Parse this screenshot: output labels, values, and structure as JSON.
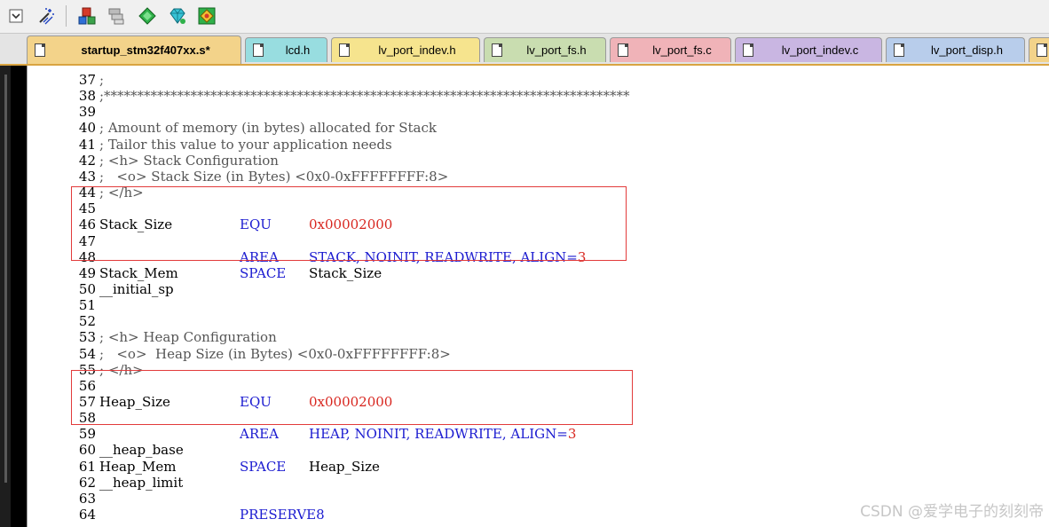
{
  "toolbar": {
    "buttons": [
      {
        "name": "dropdown-icon"
      },
      {
        "name": "magic-wand-icon"
      },
      {
        "name": "component-icon"
      },
      {
        "name": "stack-layers-icon"
      },
      {
        "name": "diamond-green-icon"
      },
      {
        "name": "gem-icon"
      },
      {
        "name": "network-pack-icon"
      }
    ]
  },
  "tabs": [
    {
      "label": "startup_stm32f407xx.s*",
      "color": "#f3d38a",
      "active": true
    },
    {
      "label": "lcd.h",
      "color": "#98dde0",
      "active": false
    },
    {
      "label": "lv_port_indev.h",
      "color": "#f6e48e",
      "active": false
    },
    {
      "label": "lv_port_fs.h",
      "color": "#c9ddb0",
      "active": false
    },
    {
      "label": "lv_port_fs.c",
      "color": "#f0b3b8",
      "active": false
    },
    {
      "label": "lv_port_indev.c",
      "color": "#c9b6e2",
      "active": false
    },
    {
      "label": "lv_port_disp.h",
      "color": "#b8cdeb",
      "active": false
    },
    {
      "label": "",
      "color": "#f3d38a",
      "active": false
    }
  ],
  "code": {
    "lines": [
      {
        "n": "37",
        "c1": ";",
        "c2": "",
        "c3": ""
      },
      {
        "n": "38",
        "c1": ";*******************************************************************************",
        "c2": "",
        "c3": ""
      },
      {
        "n": "39",
        "c1": "",
        "c2": "",
        "c3": ""
      },
      {
        "n": "40",
        "c1": "; Amount of memory (in bytes) allocated for Stack",
        "c2": "",
        "c3": ""
      },
      {
        "n": "41",
        "c1": "; Tailor this value to your application needs",
        "c2": "",
        "c3": ""
      },
      {
        "n": "42",
        "c1": "; <h> Stack Configuration",
        "c2": "",
        "c3": ""
      },
      {
        "n": "43",
        "c1": ";   <o> Stack Size (in Bytes) <0x0-0xFFFFFFFF:8>",
        "c2": "",
        "c3": ""
      },
      {
        "n": "44",
        "c1": "; </h>",
        "c2": "",
        "c3": ""
      },
      {
        "n": "45",
        "c1": "",
        "c2": "",
        "c3": ""
      },
      {
        "n": "46",
        "c1": "Stack_Size",
        "c2": "EQU",
        "c3": "0x00002000"
      },
      {
        "n": "47",
        "c1": "",
        "c2": "",
        "c3": ""
      },
      {
        "n": "48",
        "c1": "",
        "c2": "AREA",
        "c3": "STACK, NOINIT, READWRITE, ALIGN=",
        "c3b": "3"
      },
      {
        "n": "49",
        "c1": "Stack_Mem",
        "c2": "SPACE",
        "c3": "Stack_Size"
      },
      {
        "n": "50",
        "c1": "__initial_sp",
        "c2": "",
        "c3": ""
      },
      {
        "n": "51",
        "c1": "",
        "c2": "",
        "c3": ""
      },
      {
        "n": "52",
        "c1": "",
        "c2": "",
        "c3": ""
      },
      {
        "n": "53",
        "c1": "; <h> Heap Configuration",
        "c2": "",
        "c3": ""
      },
      {
        "n": "54",
        "c1": ";   <o>  Heap Size (in Bytes) <0x0-0xFFFFFFFF:8>",
        "c2": "",
        "c3": ""
      },
      {
        "n": "55",
        "c1": "; </h>",
        "c2": "",
        "c3": ""
      },
      {
        "n": "56",
        "c1": "",
        "c2": "",
        "c3": ""
      },
      {
        "n": "57",
        "c1": "Heap_Size",
        "c2": "EQU",
        "c3": "0x00002000"
      },
      {
        "n": "58",
        "c1": "",
        "c2": "",
        "c3": ""
      },
      {
        "n": "59",
        "c1": "",
        "c2": "AREA",
        "c3": "HEAP, NOINIT, READWRITE, ALIGN=",
        "c3b": "3"
      },
      {
        "n": "60",
        "c1": "__heap_base",
        "c2": "",
        "c3": ""
      },
      {
        "n": "61",
        "c1": "Heap_Mem",
        "c2": "SPACE",
        "c3": "Heap_Size"
      },
      {
        "n": "62",
        "c1": "__heap_limit",
        "c2": "",
        "c3": ""
      },
      {
        "n": "63",
        "c1": "",
        "c2": "",
        "c3": ""
      },
      {
        "n": "64",
        "c1": "",
        "c2": "PRESERVE8",
        "c3": ""
      }
    ]
  },
  "watermark": "CSDN @爱学电子的刻刻帝",
  "colors": {
    "keyword": "#1b1bd0",
    "hex_literal": "#d8261f",
    "comment": "#555555",
    "highlight_box": "#e23b3b",
    "tab_underline": "#d9a441"
  }
}
